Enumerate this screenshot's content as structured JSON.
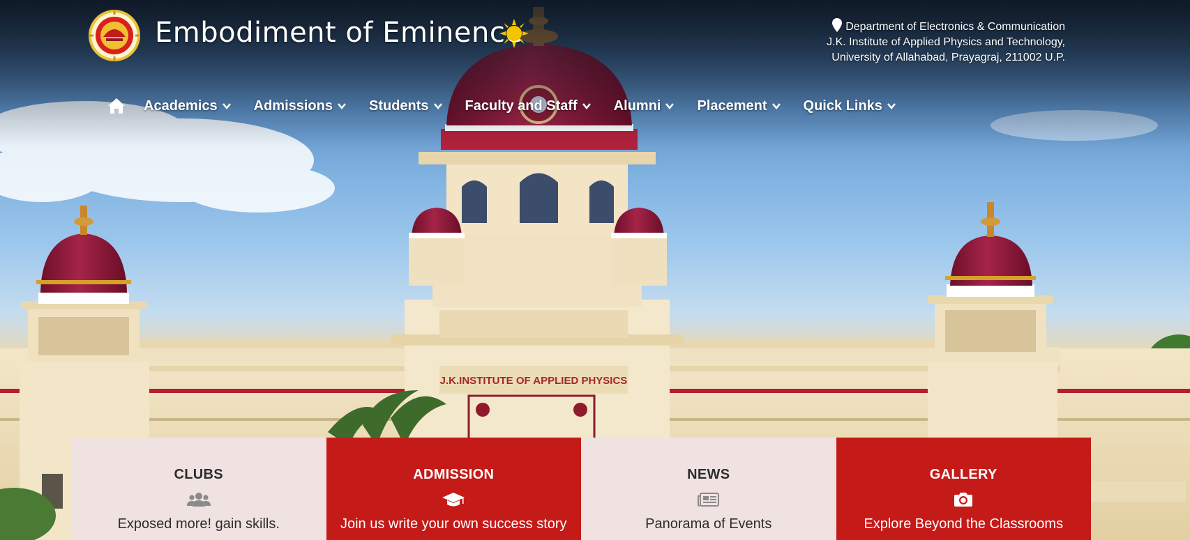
{
  "header": {
    "site_title": "Embodiment of Eminence",
    "address_lines": [
      "Department of Electronics & Communication",
      "J.K. Institute of Applied Physics and Technology,",
      "University of Allahabad, Prayagraj, 211002 U.P."
    ]
  },
  "nav": {
    "items": [
      {
        "label": "Academics"
      },
      {
        "label": "Admissions"
      },
      {
        "label": "Students"
      },
      {
        "label": "Faculty and Staff"
      },
      {
        "label": "Alumni"
      },
      {
        "label": "Placement"
      },
      {
        "label": "Quick Links"
      }
    ]
  },
  "hero": {
    "building_inscription": "J.K.INSTITUTE OF APPLIED PHYSICS"
  },
  "cards": [
    {
      "title": "CLUBS",
      "subtitle": "Exposed more! gain skills.",
      "icon": "users-icon",
      "style": "light"
    },
    {
      "title": "ADMISSION",
      "subtitle": "Join us write your own success story",
      "icon": "graduation-cap-icon",
      "style": "red"
    },
    {
      "title": "NEWS",
      "subtitle": "Panorama of Events",
      "icon": "newspaper-icon",
      "style": "light"
    },
    {
      "title": "GALLERY",
      "subtitle": "Explore Beyond the Classrooms",
      "icon": "camera-icon",
      "style": "red"
    }
  ],
  "colors": {
    "accent_red": "#c41a18",
    "card_light": "#f1e2e2",
    "dome_maroon": "#8e1a36"
  }
}
